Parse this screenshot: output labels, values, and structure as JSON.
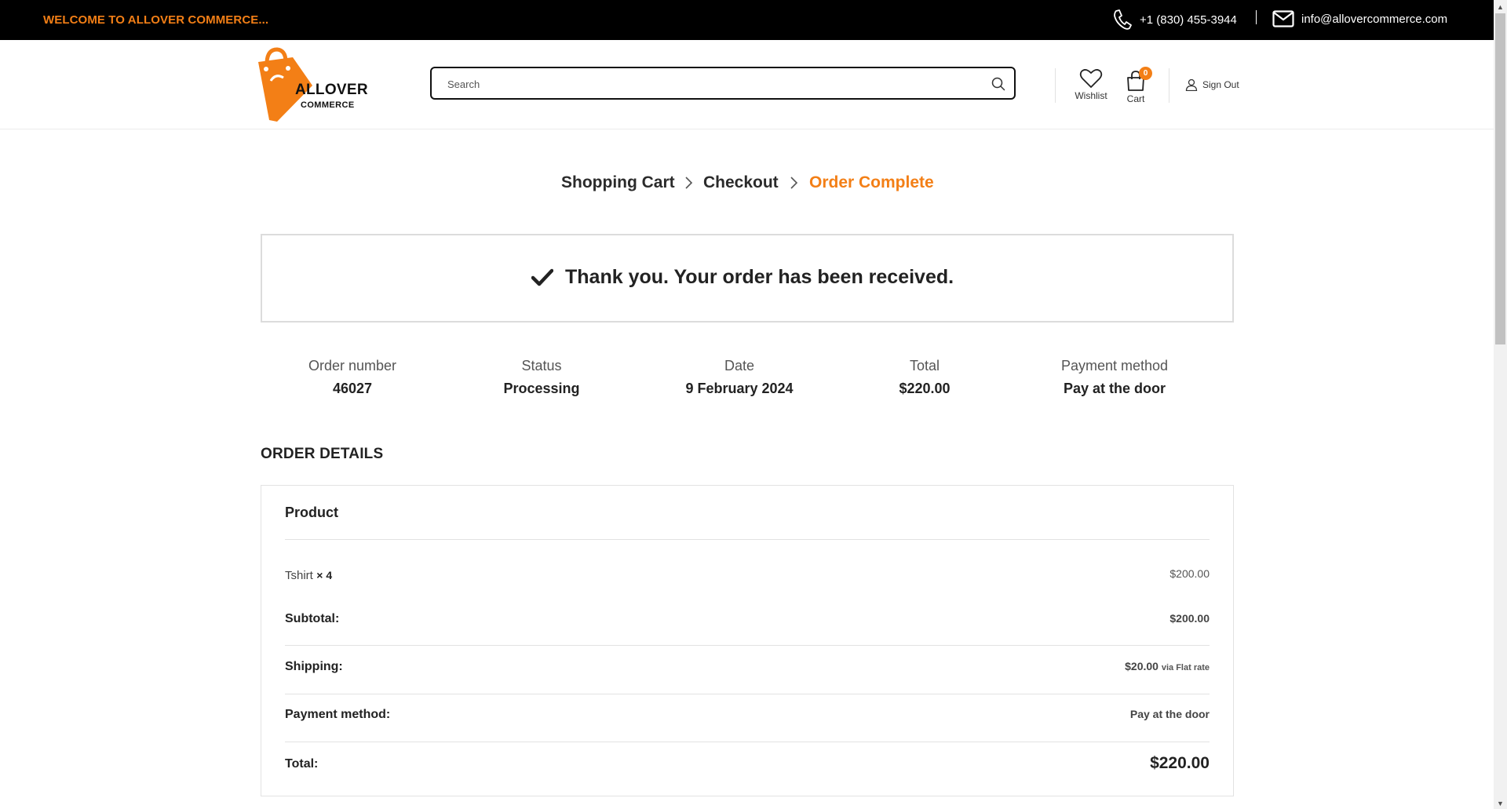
{
  "topbar": {
    "welcome": "WELCOME TO ALLOVER COMMERCE...",
    "phone": "+1 (830) 455-3944",
    "email": "info@allovercommerce.com"
  },
  "header": {
    "logo_line1": "ALLOVER",
    "logo_line2": "COMMERCE",
    "search_placeholder": "Search",
    "search_value": "",
    "wishlist_label": "Wishlist",
    "cart_label": "Cart",
    "cart_count": "0",
    "signout_label": "Sign Out"
  },
  "breadcrumb": {
    "steps": [
      "Shopping Cart",
      "Checkout",
      "Order Complete"
    ],
    "active_index": 2
  },
  "notice": {
    "message": "Thank you. Your order has been received."
  },
  "overview": {
    "order_number": {
      "label": "Order number",
      "value": "46027"
    },
    "status": {
      "label": "Status",
      "value": "Processing"
    },
    "date": {
      "label": "Date",
      "value": "9 February 2024"
    },
    "total": {
      "label": "Total",
      "value": "$220.00"
    },
    "payment_method": {
      "label": "Payment method",
      "value": "Pay at the door"
    }
  },
  "order_details": {
    "heading": "ORDER DETAILS",
    "column_header": "Product",
    "item": {
      "name": "Tshirt",
      "qty": "× 4",
      "price": "$200.00"
    },
    "subtotal": {
      "label": "Subtotal:",
      "value": "$200.00"
    },
    "shipping": {
      "label": "Shipping:",
      "value": "$20.00",
      "note": "via Flat rate"
    },
    "payment": {
      "label": "Payment method:",
      "value": "Pay at the door"
    },
    "total": {
      "label": "Total:",
      "value": "$220.00"
    }
  },
  "colors": {
    "accent": "#f37f16",
    "topbar_bg": "#000000",
    "text": "#222222"
  }
}
